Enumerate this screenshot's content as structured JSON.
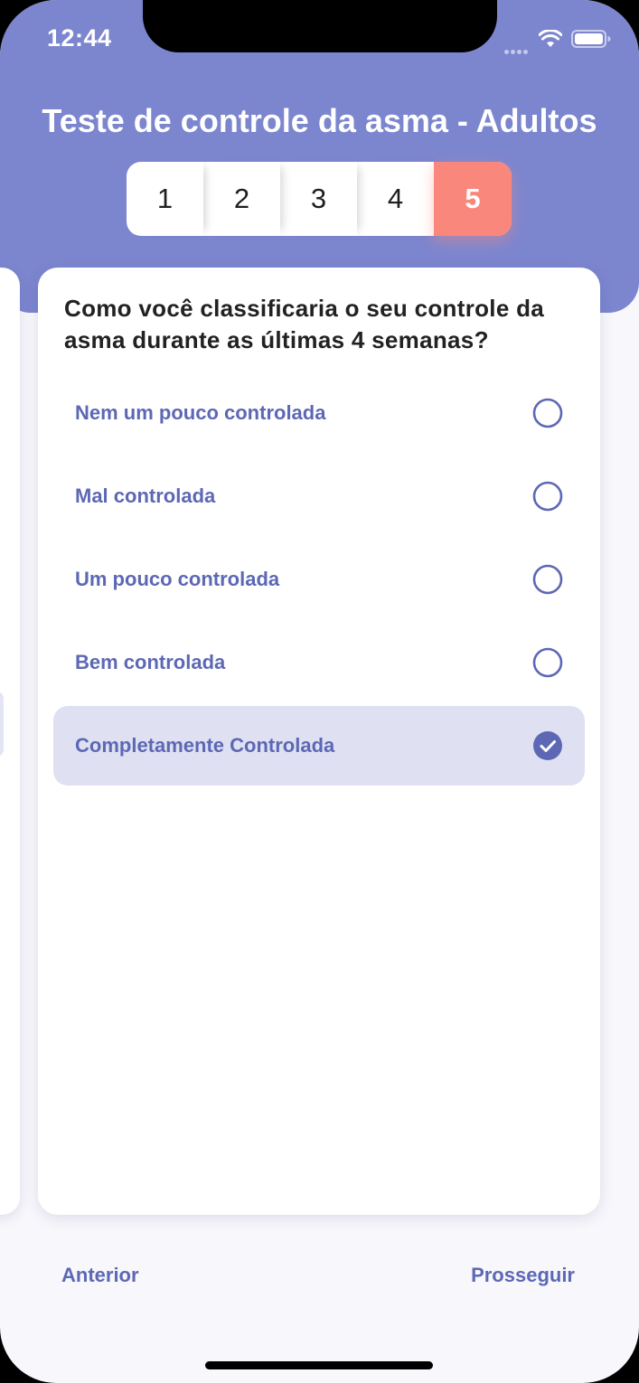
{
  "status_bar": {
    "time": "12:44"
  },
  "header": {
    "title": "Teste de controle da asma - Adultos"
  },
  "stepper": {
    "steps": [
      {
        "label": "1",
        "active": false
      },
      {
        "label": "2",
        "active": false
      },
      {
        "label": "3",
        "active": false
      },
      {
        "label": "4",
        "active": false
      },
      {
        "label": "5",
        "active": true
      }
    ]
  },
  "question": {
    "text": "Como você classificaria o seu controle da asma durante as últimas 4 semanas?",
    "options": [
      {
        "label": "Nem um pouco controlada",
        "selected": false
      },
      {
        "label": "Mal controlada",
        "selected": false
      },
      {
        "label": "Um pouco controlada",
        "selected": false
      },
      {
        "label": "Bem controlada",
        "selected": false
      },
      {
        "label": "Completamente Controlada",
        "selected": true
      }
    ]
  },
  "navigation": {
    "previous_label": "Anterior",
    "next_label": "Prosseguir"
  },
  "colors": {
    "header": "#7C86CF",
    "accent": "#5D68B5",
    "active_step": "#FA877C",
    "selected_option": "#DFE1F3"
  },
  "icons": {
    "wifi": "wifi-icon",
    "battery": "battery-icon",
    "radio_empty": "radio-empty-icon",
    "radio_checked": "checkmark-circle-icon"
  }
}
